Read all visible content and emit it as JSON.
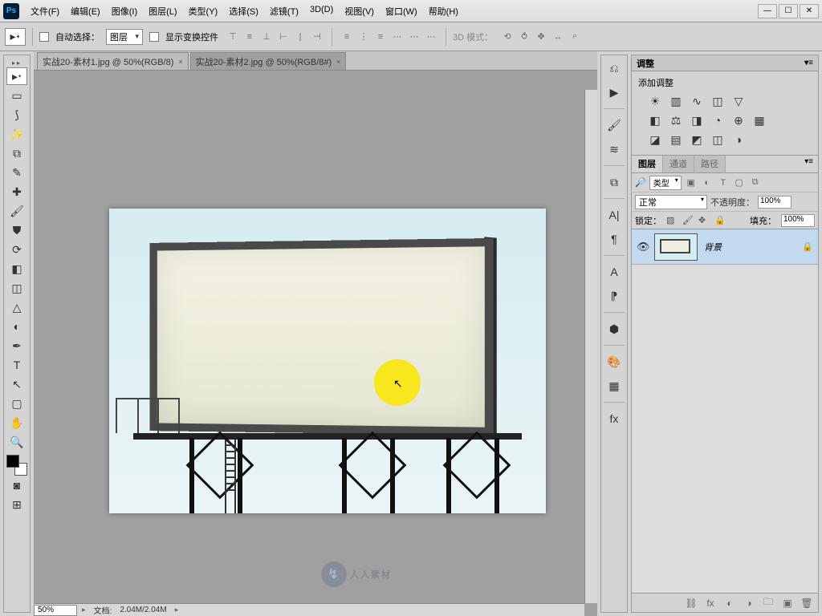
{
  "menus": [
    "文件(F)",
    "编辑(E)",
    "图像(I)",
    "图层(L)",
    "类型(Y)",
    "选择(S)",
    "滤镜(T)",
    "3D(D)",
    "视图(V)",
    "窗口(W)",
    "帮助(H)"
  ],
  "options": {
    "auto_select": "自动选择：",
    "layer_select": "图层",
    "show_transform": "显示变换控件",
    "mode3d": "3D 模式："
  },
  "tabs": [
    {
      "label": "实战20-素材1.jpg @ 50%(RGB/8)",
      "active": false
    },
    {
      "label": "实战20-素材2.jpg @ 50%(RGB/8#)",
      "active": true
    }
  ],
  "status": {
    "zoom": "50%",
    "doc_label": "文档:",
    "doc_size": "2.04M/2.04M"
  },
  "adjustments": {
    "panel_title": "调整",
    "add_label": "添加调整"
  },
  "layers_panel": {
    "tabs": [
      "图层",
      "通道",
      "路径"
    ],
    "filter_label": "类型",
    "blend_mode": "正常",
    "opacity_label": "不透明度：",
    "opacity_value": "100%",
    "lock_label": "锁定：",
    "fill_label": "填充：",
    "fill_value": "100%",
    "layer_name": "背景"
  },
  "watermark": "人人素材"
}
